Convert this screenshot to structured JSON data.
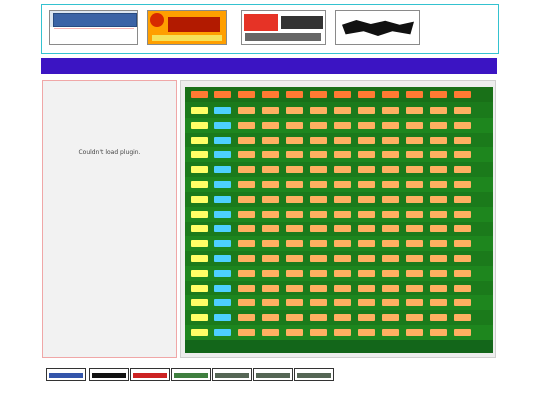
{
  "banner": {
    "logos": [
      {
        "name": "sichuan-salt-school-logo"
      },
      {
        "name": "sohu-alumni-logo"
      },
      {
        "name": "163-alumni-logo"
      },
      {
        "name": "chinese-alumni-logo"
      }
    ]
  },
  "nav": {
    "items": [
      {
        "label": ""
      },
      {
        "label": ""
      },
      {
        "label": ""
      },
      {
        "label": ""
      },
      {
        "label": ""
      },
      {
        "label": ""
      },
      {
        "label": ""
      },
      {
        "label": ""
      },
      {
        "label": ""
      },
      {
        "label": ""
      }
    ]
  },
  "plugin": {
    "message": "Couldn't load plugin."
  },
  "grid": {
    "header": [
      {
        "t": ""
      },
      {
        "t": ""
      },
      {
        "t": ""
      },
      {
        "t": ""
      },
      {
        "t": ""
      },
      {
        "t": ""
      },
      {
        "t": ""
      },
      {
        "t": ""
      },
      {
        "t": ""
      },
      {
        "t": ""
      },
      {
        "t": ""
      },
      {
        "t": ""
      }
    ],
    "rows": [
      {
        "c": [
          {
            "t": ""
          },
          {
            "t": ""
          },
          {
            "t": ""
          },
          {
            "t": ""
          },
          {
            "t": ""
          },
          {
            "t": ""
          },
          {
            "t": ""
          },
          {
            "t": ""
          },
          {
            "t": ""
          },
          {
            "t": ""
          },
          {
            "t": ""
          },
          {
            "t": ""
          }
        ]
      },
      {
        "c": [
          {
            "t": ""
          },
          {
            "t": ""
          },
          {
            "t": ""
          },
          {
            "t": ""
          },
          {
            "t": ""
          },
          {
            "t": ""
          },
          {
            "t": ""
          },
          {
            "t": ""
          },
          {
            "t": ""
          },
          {
            "t": ""
          },
          {
            "t": ""
          },
          {
            "t": ""
          }
        ]
      },
      {
        "c": [
          {
            "t": ""
          },
          {
            "t": ""
          },
          {
            "t": ""
          },
          {
            "t": ""
          },
          {
            "t": ""
          },
          {
            "t": ""
          },
          {
            "t": ""
          },
          {
            "t": ""
          },
          {
            "t": ""
          },
          {
            "t": ""
          },
          {
            "t": ""
          },
          {
            "t": ""
          }
        ]
      },
      {
        "c": [
          {
            "t": ""
          },
          {
            "t": ""
          },
          {
            "t": ""
          },
          {
            "t": ""
          },
          {
            "t": ""
          },
          {
            "t": ""
          },
          {
            "t": ""
          },
          {
            "t": ""
          },
          {
            "t": ""
          },
          {
            "t": ""
          },
          {
            "t": ""
          },
          {
            "t": ""
          }
        ]
      },
      {
        "c": [
          {
            "t": ""
          },
          {
            "t": ""
          },
          {
            "t": ""
          },
          {
            "t": ""
          },
          {
            "t": ""
          },
          {
            "t": ""
          },
          {
            "t": ""
          },
          {
            "t": ""
          },
          {
            "t": ""
          },
          {
            "t": ""
          },
          {
            "t": ""
          },
          {
            "t": ""
          }
        ]
      },
      {
        "c": [
          {
            "t": ""
          },
          {
            "t": ""
          },
          {
            "t": ""
          },
          {
            "t": ""
          },
          {
            "t": ""
          },
          {
            "t": ""
          },
          {
            "t": ""
          },
          {
            "t": ""
          },
          {
            "t": ""
          },
          {
            "t": ""
          },
          {
            "t": ""
          },
          {
            "t": ""
          }
        ]
      },
      {
        "c": [
          {
            "t": ""
          },
          {
            "t": ""
          },
          {
            "t": ""
          },
          {
            "t": ""
          },
          {
            "t": ""
          },
          {
            "t": ""
          },
          {
            "t": ""
          },
          {
            "t": ""
          },
          {
            "t": ""
          },
          {
            "t": ""
          },
          {
            "t": ""
          },
          {
            "t": ""
          }
        ]
      },
      {
        "c": [
          {
            "t": ""
          },
          {
            "t": ""
          },
          {
            "t": ""
          },
          {
            "t": ""
          },
          {
            "t": ""
          },
          {
            "t": ""
          },
          {
            "t": ""
          },
          {
            "t": ""
          },
          {
            "t": ""
          },
          {
            "t": ""
          },
          {
            "t": ""
          },
          {
            "t": ""
          }
        ]
      },
      {
        "c": [
          {
            "t": ""
          },
          {
            "t": ""
          },
          {
            "t": ""
          },
          {
            "t": ""
          },
          {
            "t": ""
          },
          {
            "t": ""
          },
          {
            "t": ""
          },
          {
            "t": ""
          },
          {
            "t": ""
          },
          {
            "t": ""
          },
          {
            "t": ""
          },
          {
            "t": ""
          }
        ]
      },
      {
        "c": [
          {
            "t": ""
          },
          {
            "t": ""
          },
          {
            "t": ""
          },
          {
            "t": ""
          },
          {
            "t": ""
          },
          {
            "t": ""
          },
          {
            "t": ""
          },
          {
            "t": ""
          },
          {
            "t": ""
          },
          {
            "t": ""
          },
          {
            "t": ""
          },
          {
            "t": ""
          }
        ]
      },
      {
        "c": [
          {
            "t": ""
          },
          {
            "t": ""
          },
          {
            "t": ""
          },
          {
            "t": ""
          },
          {
            "t": ""
          },
          {
            "t": ""
          },
          {
            "t": ""
          },
          {
            "t": ""
          },
          {
            "t": ""
          },
          {
            "t": ""
          },
          {
            "t": ""
          },
          {
            "t": ""
          }
        ]
      },
      {
        "c": [
          {
            "t": ""
          },
          {
            "t": ""
          },
          {
            "t": ""
          },
          {
            "t": ""
          },
          {
            "t": ""
          },
          {
            "t": ""
          },
          {
            "t": ""
          },
          {
            "t": ""
          },
          {
            "t": ""
          },
          {
            "t": ""
          },
          {
            "t": ""
          },
          {
            "t": ""
          }
        ]
      },
      {
        "c": [
          {
            "t": ""
          },
          {
            "t": ""
          },
          {
            "t": ""
          },
          {
            "t": ""
          },
          {
            "t": ""
          },
          {
            "t": ""
          },
          {
            "t": ""
          },
          {
            "t": ""
          },
          {
            "t": ""
          },
          {
            "t": ""
          },
          {
            "t": ""
          },
          {
            "t": ""
          }
        ]
      },
      {
        "c": [
          {
            "t": ""
          },
          {
            "t": ""
          },
          {
            "t": ""
          },
          {
            "t": ""
          },
          {
            "t": ""
          },
          {
            "t": ""
          },
          {
            "t": ""
          },
          {
            "t": ""
          },
          {
            "t": ""
          },
          {
            "t": ""
          },
          {
            "t": ""
          },
          {
            "t": ""
          }
        ]
      },
      {
        "c": [
          {
            "t": ""
          },
          {
            "t": ""
          },
          {
            "t": ""
          },
          {
            "t": ""
          },
          {
            "t": ""
          },
          {
            "t": ""
          },
          {
            "t": ""
          },
          {
            "t": ""
          },
          {
            "t": ""
          },
          {
            "t": ""
          },
          {
            "t": ""
          },
          {
            "t": ""
          }
        ]
      },
      {
        "c": [
          {
            "t": ""
          },
          {
            "t": ""
          },
          {
            "t": ""
          },
          {
            "t": ""
          },
          {
            "t": ""
          },
          {
            "t": ""
          },
          {
            "t": ""
          },
          {
            "t": ""
          },
          {
            "t": ""
          },
          {
            "t": ""
          },
          {
            "t": ""
          },
          {
            "t": ""
          }
        ]
      }
    ],
    "footer": ""
  },
  "links": [
    {
      "name": "friend-link-1",
      "color": "#3355aa"
    },
    {
      "name": "friend-link-2",
      "color": "#111111"
    },
    {
      "name": "friend-link-3",
      "color": "#cc2222"
    },
    {
      "name": "friend-link-4",
      "color": "#3f7f3f"
    },
    {
      "name": "friend-link-5",
      "color": "#556655"
    },
    {
      "name": "friend-link-6",
      "color": "#556655"
    },
    {
      "name": "friend-link-7",
      "color": "#556655"
    }
  ],
  "footer": {
    "line1": "",
    "badge": "",
    "line2": ""
  }
}
